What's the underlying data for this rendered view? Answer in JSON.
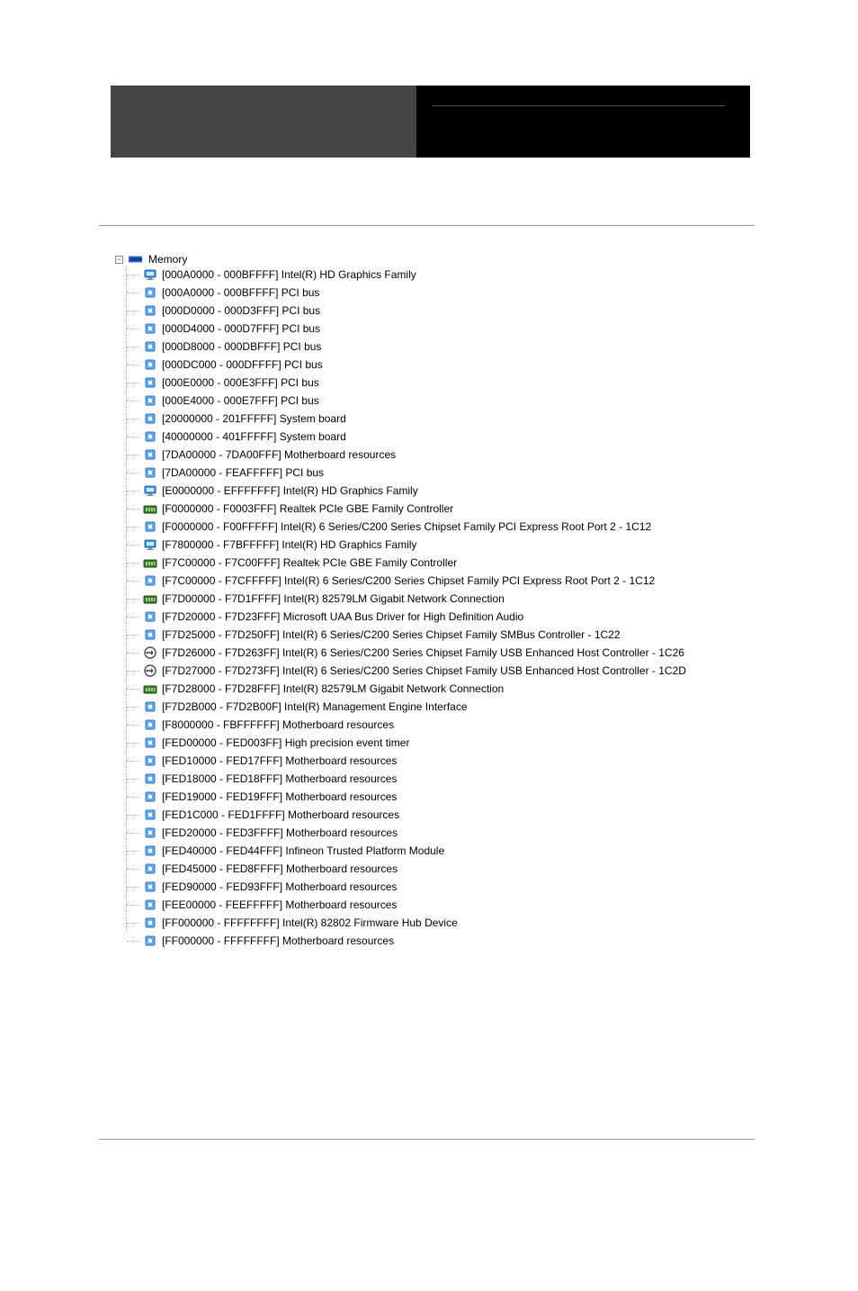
{
  "root_label": "Memory",
  "items": [
    {
      "icon": "display",
      "range": "[000A0000 - 000BFFFF]",
      "device": "Intel(R) HD Graphics Family"
    },
    {
      "icon": "chip",
      "range": "[000A0000 - 000BFFFF]",
      "device": "PCI bus"
    },
    {
      "icon": "chip",
      "range": "[000D0000 - 000D3FFF]",
      "device": "PCI bus"
    },
    {
      "icon": "chip",
      "range": "[000D4000 - 000D7FFF]",
      "device": "PCI bus"
    },
    {
      "icon": "chip",
      "range": "[000D8000 - 000DBFFF]",
      "device": "PCI bus"
    },
    {
      "icon": "chip",
      "range": "[000DC000 - 000DFFFF]",
      "device": "PCI bus"
    },
    {
      "icon": "chip",
      "range": "[000E0000 - 000E3FFF]",
      "device": "PCI bus"
    },
    {
      "icon": "chip",
      "range": "[000E4000 - 000E7FFF]",
      "device": "PCI bus"
    },
    {
      "icon": "chip",
      "range": "[20000000 - 201FFFFF]",
      "device": "System board"
    },
    {
      "icon": "chip",
      "range": "[40000000 - 401FFFFF]",
      "device": "System board"
    },
    {
      "icon": "chip",
      "range": "[7DA00000 - 7DA00FFF]",
      "device": "Motherboard resources"
    },
    {
      "icon": "chip",
      "range": "[7DA00000 - FEAFFFFF]",
      "device": "PCI bus"
    },
    {
      "icon": "display",
      "range": "[E0000000 - EFFFFFFF]",
      "device": "Intel(R) HD Graphics Family"
    },
    {
      "icon": "net",
      "range": "[F0000000 - F0003FFF]",
      "device": "Realtek PCIe GBE Family Controller"
    },
    {
      "icon": "chip",
      "range": "[F0000000 - F00FFFFF]",
      "device": "Intel(R) 6 Series/C200 Series Chipset Family PCI Express Root Port 2 - 1C12"
    },
    {
      "icon": "display",
      "range": "[F7800000 - F7BFFFFF]",
      "device": "Intel(R) HD Graphics Family"
    },
    {
      "icon": "net",
      "range": "[F7C00000 - F7C00FFF]",
      "device": "Realtek PCIe GBE Family Controller"
    },
    {
      "icon": "chip",
      "range": "[F7C00000 - F7CFFFFF]",
      "device": "Intel(R) 6 Series/C200 Series Chipset Family PCI Express Root Port 2 - 1C12"
    },
    {
      "icon": "net",
      "range": "[F7D00000 - F7D1FFFF]",
      "device": "Intel(R) 82579LM Gigabit Network Connection"
    },
    {
      "icon": "chip",
      "range": "[F7D20000 - F7D23FFF]",
      "device": "Microsoft UAA Bus Driver for High Definition Audio"
    },
    {
      "icon": "chip",
      "range": "[F7D25000 - F7D250FF]",
      "device": "Intel(R) 6 Series/C200 Series Chipset Family SMBus Controller - 1C22"
    },
    {
      "icon": "usb",
      "range": "[F7D26000 - F7D263FF]",
      "device": "Intel(R) 6 Series/C200 Series Chipset Family USB Enhanced Host Controller - 1C26"
    },
    {
      "icon": "usb",
      "range": "[F7D27000 - F7D273FF]",
      "device": "Intel(R) 6 Series/C200 Series Chipset Family USB Enhanced Host Controller - 1C2D"
    },
    {
      "icon": "net",
      "range": "[F7D28000 - F7D28FFF]",
      "device": "Intel(R) 82579LM Gigabit Network Connection"
    },
    {
      "icon": "chip",
      "range": "[F7D2B000 - F7D2B00F]",
      "device": "Intel(R) Management Engine Interface"
    },
    {
      "icon": "chip",
      "range": "[F8000000 - FBFFFFFF]",
      "device": "Motherboard resources"
    },
    {
      "icon": "chip",
      "range": "[FED00000 - FED003FF]",
      "device": "High precision event timer"
    },
    {
      "icon": "chip",
      "range": "[FED10000 - FED17FFF]",
      "device": "Motherboard resources"
    },
    {
      "icon": "chip",
      "range": "[FED18000 - FED18FFF]",
      "device": "Motherboard resources"
    },
    {
      "icon": "chip",
      "range": "[FED19000 - FED19FFF]",
      "device": "Motherboard resources"
    },
    {
      "icon": "chip",
      "range": "[FED1C000 - FED1FFFF]",
      "device": "Motherboard resources"
    },
    {
      "icon": "chip",
      "range": "[FED20000 - FED3FFFF]",
      "device": "Motherboard resources"
    },
    {
      "icon": "chip",
      "range": "[FED40000 - FED44FFF]",
      "device": "Infineon Trusted Platform Module"
    },
    {
      "icon": "chip",
      "range": "[FED45000 - FED8FFFF]",
      "device": "Motherboard resources"
    },
    {
      "icon": "chip",
      "range": "[FED90000 - FED93FFF]",
      "device": "Motherboard resources"
    },
    {
      "icon": "chip",
      "range": "[FEE00000 - FEEFFFFF]",
      "device": "Motherboard resources"
    },
    {
      "icon": "chip",
      "range": "[FF000000 - FFFFFFFF]",
      "device": "Intel(R) 82802 Firmware Hub Device"
    },
    {
      "icon": "chip",
      "range": "[FF000000 - FFFFFFFF]",
      "device": "Motherboard resources"
    }
  ]
}
